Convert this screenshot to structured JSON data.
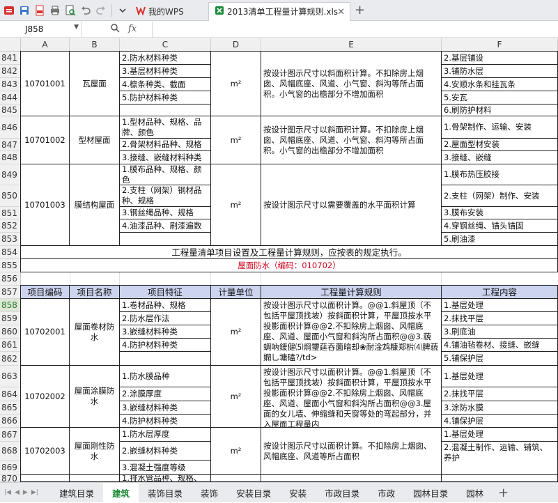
{
  "tabs": {
    "wps": "我的WPS",
    "file": "2013清单工程量计算规则.xls"
  },
  "formula_bar": {
    "cell_ref": "J858",
    "fx": "fx",
    "content": ""
  },
  "columns": [
    "A",
    "B",
    "C",
    "D",
    "E",
    "F"
  ],
  "rows": [
    "841",
    "842",
    "843",
    "844",
    "845",
    "846",
    "847",
    "848",
    "849",
    "850",
    "851",
    "852",
    "853",
    "854",
    "855",
    "856",
    "857",
    "858",
    "859",
    "860",
    "861",
    "862",
    "863",
    "864",
    "865",
    "866",
    "867",
    "868",
    "869",
    "870"
  ],
  "selected_row": "858",
  "items": [
    {
      "code": "10701001",
      "name": "瓦屋面",
      "unit": "m²",
      "features": [
        "2.防水材料种类",
        "3.基层材料种类",
        "4.檩条种类、截面",
        "5.防护材料种类"
      ],
      "rule": "按设计图示尺寸以斜面积计算。不扣除房上烟囱、风帽底座、风道、小气窗、斜沟等所占面积。小气窗的出檐部分不增加面积",
      "content": [
        "2.基层铺设",
        "3.铺防水层",
        "4.安顺水条和挂瓦条",
        "5.安瓦",
        "6.刷防护材料"
      ]
    },
    {
      "code": "10701002",
      "name": "型材屋面",
      "unit": "m²",
      "features": [
        "1.型材品种、规格、品牌、颜色",
        "2.骨架材料品种、规格",
        "3.接缝、嵌缝材料种类"
      ],
      "rule": "按设计图示尺寸以斜面积计算。不扣除房上烟囱、风帽底座、风道、小气窗、斜沟等所占面积。小气窗的出檐部分不增加面积",
      "content": [
        "1.骨架制作、运输、安装",
        "2.屋面型材安装",
        "3.接缝、嵌缝"
      ]
    },
    {
      "code": "10701003",
      "name": "膜结构屋面",
      "unit": "m²",
      "features": [
        "1.膜布品种、规格、颜色",
        "2.支柱（网架）钢材品种、规格",
        "3.钢丝绳品种、规格",
        "4.油漆品种、刷漆遍数"
      ],
      "rule": "按设计图示尺寸以需要覆盖的水平面积计算",
      "content": [
        "1.膜布热压胶接",
        "2.支柱（网架）制作、安装",
        "3.膜布安装",
        "4.穿钢丝绳、锚头锚固",
        "5.刷油漆"
      ]
    }
  ],
  "note": "工程量清单项目设置及工程量计算规则，应按表的规定执行。",
  "section_title": "屋面防水（编码：010702）",
  "header": {
    "code": "项目编码",
    "name": "项目名称",
    "feature": "项目特征",
    "unit": "计量单位",
    "rule": "工程量计算规则",
    "content": "工程内容"
  },
  "items2": [
    {
      "code": "10702001",
      "name": "屋面卷材防水",
      "unit": "m²",
      "features": [
        "1.卷材品种、规格",
        "2.防水层作法",
        "3.嵌缝材料种类",
        "4.防护材料种类"
      ],
      "rule": "按设计图示尺寸以面积计算。@@1.斜屋顶（不包括平屋顶找坡）按斜面积计算，平屋顶按水平投影面积计算@@2.不扣除房上烟囱、风帽底座、风道、屋面小气窗和斜沟所占面积@@3.藐蜩吶鍰健⑸烱瓕莛吞薗暗却❀耐淦鸩糠郑㭊⑷脾藐嫻乚墉磕?/td>",
      "content": [
        "1.基层处理",
        "2.抹找平层",
        "3.刷底油",
        "4.铺油毡卷材、接缝、嵌缝",
        "5.铺保护层"
      ]
    },
    {
      "code": "10702002",
      "name": "屋面涂膜防水",
      "unit": "m²",
      "features": [
        "1.防水膜品种",
        "2.涂膜厚度",
        "3.嵌缝材料种类",
        "4.防护材料种类"
      ],
      "rule": "按设计图示尺寸以面积计算。@@1.斜屋顶（不包括平屋顶找坡）按斜面积计算，平屋顶按水平投影面积计算@@2.不扣除房上烟囱、风帽底座、风道、屋面小气窗和斜沟所占面积@@3.屋面的女儿墙、伸缩缝和天窗等处的弯起部分，并入屋面工程量内",
      "content": [
        "1.基层处理",
        "2.抹找平层",
        "3.涂防水膜",
        "4.铺保护层"
      ]
    },
    {
      "code": "10702003",
      "name": "屋面刚性防水",
      "unit": "m²",
      "features": [
        "1.防水层厚度",
        "2.嵌缝材料种类",
        "3.混凝土强度等级"
      ],
      "rule": "按设计图示尺寸以面积计算。不扣除房上烟囱、风帽底座、风道等所占面积",
      "content": [
        "1.基层处理",
        "2.混凝土制作、运输、铺筑、养护"
      ]
    }
  ],
  "partial_row_text": "1.排水管品种、规格、",
  "sheets": [
    "建筑目录",
    "建筑",
    "装饰目录",
    "装饰",
    "安装目录",
    "安装",
    "市政目录",
    "市政",
    "园林目录",
    "园林"
  ],
  "active_sheet": "建筑",
  "colors": {
    "accent": "#1e8b3a",
    "header_fill": "#ccd4ef",
    "section_red": "#d0021b"
  }
}
